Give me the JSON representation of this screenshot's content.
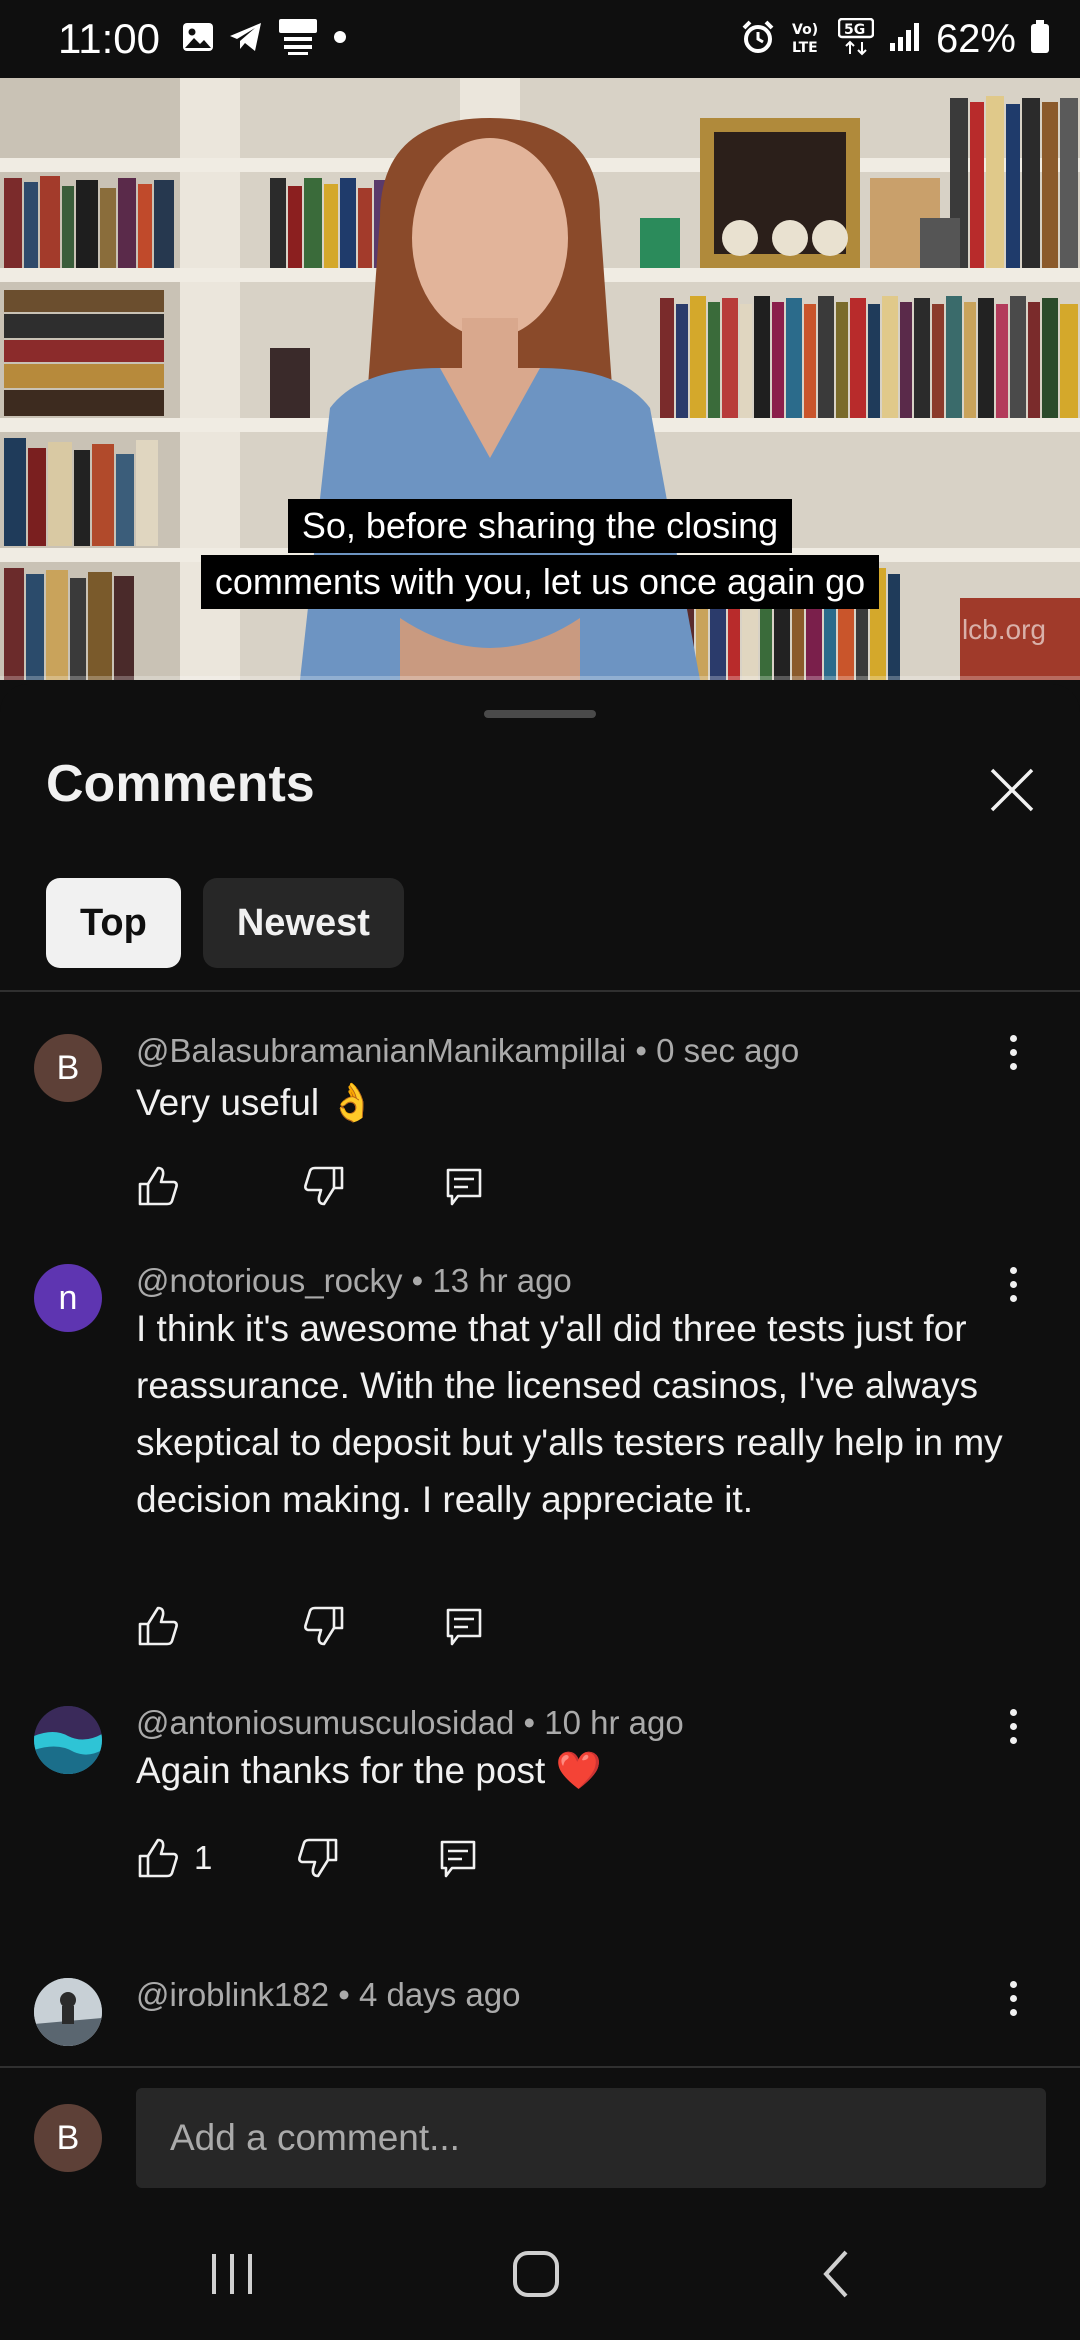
{
  "status_bar": {
    "time": "11:00",
    "battery": "62%",
    "icons": [
      "gallery-icon",
      "telegram-icon",
      "news-app-icon",
      "notification-dot-icon",
      "alarm-icon",
      "volte-icon",
      "5g-icon",
      "signal-icon",
      "battery-icon"
    ]
  },
  "video": {
    "caption_line1": "So, before sharing the closing",
    "caption_line2": "comments with you, let us once again go",
    "watermark": "lcb.org"
  },
  "comments_panel": {
    "title": "Comments",
    "filters": [
      {
        "label": "Top",
        "active": true
      },
      {
        "label": "Newest",
        "active": false
      }
    ],
    "comments": [
      {
        "avatar_letter": "B",
        "avatar_color": "#5d4037",
        "meta": "@BalasubramanianManikampillai • 0 sec ago",
        "text": "Very useful 👌",
        "likes": ""
      },
      {
        "avatar_letter": "n",
        "avatar_color": "#5e35b1",
        "meta": "@notorious_rocky • 13 hr ago",
        "text": "I think it's awesome that y'all did three tests just for reassurance. With the licensed casinos, I've always skeptical to deposit but y'alls testers really help in my decision making. I really appreciate it.",
        "likes": ""
      },
      {
        "avatar_letter": "",
        "avatar_color": "#1b3a4b",
        "meta": "@antoniosumusculosidad • 10 hr ago",
        "text": "Again thanks for the post ❤️",
        "likes": "1"
      },
      {
        "avatar_letter": "",
        "avatar_color": "#9aa4ad",
        "meta": "@iroblink182 • 4 days ago",
        "text": "",
        "likes": ""
      }
    ]
  },
  "composer": {
    "avatar_letter": "B",
    "placeholder": "Add a comment..."
  },
  "colors": {
    "background": "#0f0f0f",
    "chip_active": "#f1f1f1",
    "chip_inactive": "#272727",
    "secondary_text": "#aaaaaa"
  }
}
